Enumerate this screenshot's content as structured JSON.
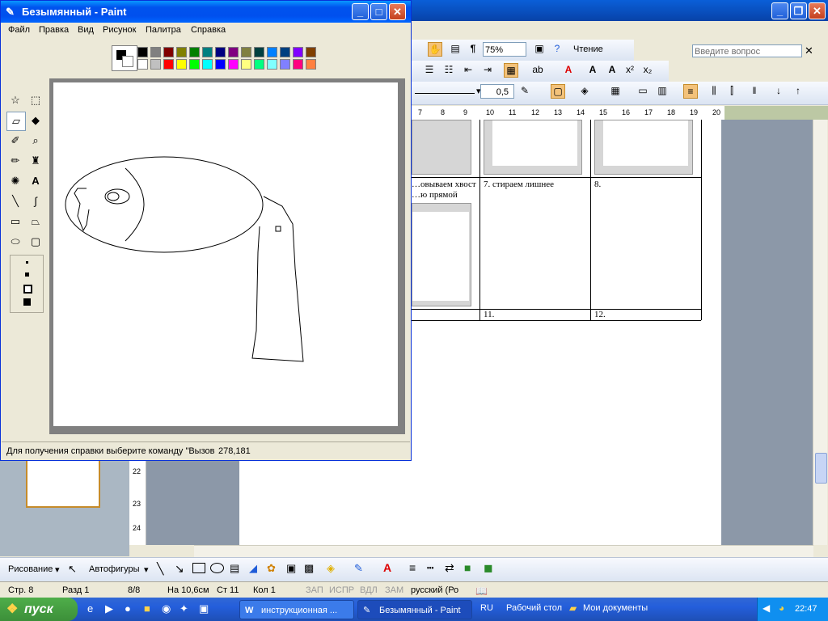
{
  "word": {
    "ask_placeholder": "Введите вопрос",
    "zoom": "75%",
    "reading_button": "Чтение",
    "line_weight": "0,5",
    "ruler_numbers": [
      "7",
      "8",
      "9",
      "10",
      "11",
      "12",
      "13",
      "14",
      "15",
      "16",
      "17",
      "18",
      "19",
      "20"
    ],
    "vertical_ruler": [
      "22",
      "23",
      "24"
    ],
    "table_cells": {
      "cell6_text": "…овываем хвост …ю прямой",
      "cell7_text": "7.   стираем лишнее",
      "cell8_text": "8.",
      "cell11_text": "11.",
      "cell12_text": "12."
    }
  },
  "drawing_toolbar": {
    "draw_label": "Рисование",
    "autoshapes_label": "Автофигуры"
  },
  "statusbar": {
    "page": "Стр.  8",
    "section": "Разд  1",
    "pages": "8/8",
    "at": "На  10,6см",
    "line": "Ст  11",
    "col": "Кол  1",
    "rec": "ЗАП",
    "trk": "ИСПР",
    "ext": "ВДЛ",
    "ovr": "ЗАМ",
    "lang": "русский (Ро"
  },
  "taskbar": {
    "start": "пуск",
    "task1": "инструкционная ...",
    "task2": "Безымянный - Paint",
    "lang": "RU",
    "desktop": "Рабочий стол",
    "documents": "Мои документы",
    "clock": "22:47"
  },
  "paint": {
    "title": "Безымянный - Paint",
    "menu": [
      "Файл",
      "Правка",
      "Вид",
      "Рисунок",
      "Палитра",
      "Справка"
    ],
    "status_text": "Для получения справки выберите команду \"Вызов",
    "coords": "278,181",
    "palette_top": [
      "#000000",
      "#808080",
      "#800000",
      "#808000",
      "#008000",
      "#008080",
      "#000080",
      "#800080",
      "#808040",
      "#004040",
      "#0080ff",
      "#004080",
      "#8000ff",
      "#804000"
    ],
    "palette_bottom": [
      "#ffffff",
      "#c0c0c0",
      "#ff0000",
      "#ffff00",
      "#00ff00",
      "#00ffff",
      "#0000ff",
      "#ff00ff",
      "#ffff80",
      "#00ff80",
      "#80ffff",
      "#8080ff",
      "#ff0080",
      "#ff8040"
    ],
    "tools": [
      "free-select-icon",
      "rect-select-icon",
      "eraser-icon",
      "fill-icon",
      "picker-icon",
      "magnifier-icon",
      "pencil-icon",
      "brush-icon",
      "airbrush-icon",
      "text-icon",
      "line-icon",
      "curve-icon",
      "rectangle-icon",
      "polygon-icon",
      "ellipse-icon",
      "rounded-rect-icon"
    ]
  }
}
